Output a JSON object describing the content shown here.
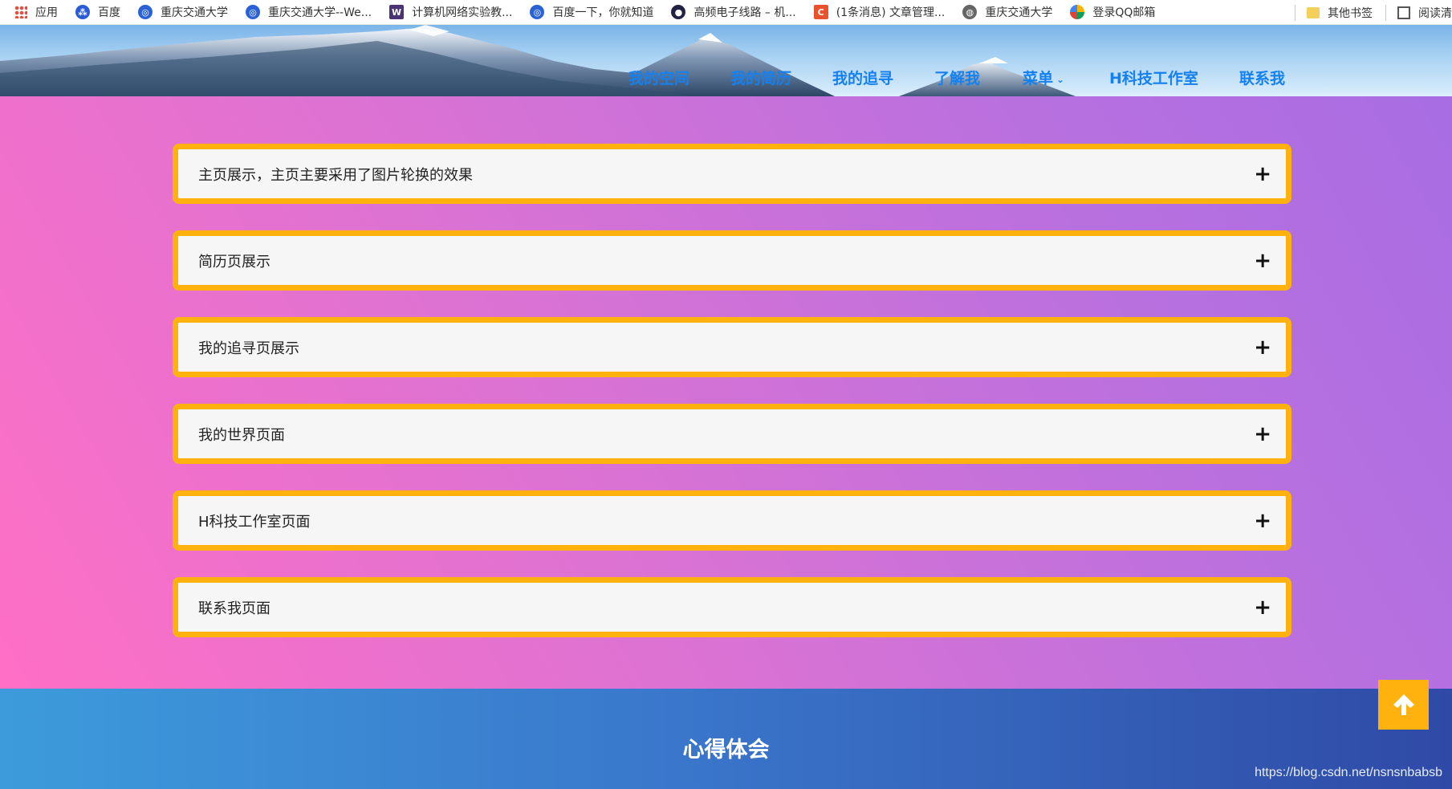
{
  "bookmarks": {
    "items": [
      {
        "label": "应用",
        "icon": "apps-grid-icon"
      },
      {
        "label": "百度",
        "icon": "baidu-paw-icon"
      },
      {
        "label": "重庆交通大学",
        "icon": "university-logo-icon"
      },
      {
        "label": "重庆交通大学--We...",
        "icon": "university-logo-icon"
      },
      {
        "label": "计算机网络实验教...",
        "icon": "w-logo-icon"
      },
      {
        "label": "百度一下，你就知道",
        "icon": "university-logo-icon"
      },
      {
        "label": "高频电子线路 – 机...",
        "icon": "dark-circle-icon"
      },
      {
        "label": "(1条消息) 文章管理...",
        "icon": "csdn-c-icon"
      },
      {
        "label": "重庆交通大学",
        "icon": "globe-icon"
      },
      {
        "label": "登录QQ邮箱",
        "icon": "qq-mail-icon"
      }
    ],
    "other_label": "其他书签",
    "reader_label": "阅读清"
  },
  "nav": {
    "items": [
      "我的空间",
      "我的简历",
      "我的追寻",
      "了解我",
      "菜单",
      "H科技工作室",
      "联系我"
    ],
    "menu_chevron": "⌄"
  },
  "accordion": {
    "items": [
      "主页展示，主页主要采用了图片轮换的效果",
      "简历页展示",
      "我的追寻页展示",
      "我的世界页面",
      "H科技工作室页面",
      "联系我页面"
    ],
    "plus": "+"
  },
  "bottom": {
    "title": "心得体会",
    "watermark": "https://blog.csdn.net/nsnsnbabsb"
  },
  "colors": {
    "accent_orange": "#ffb10d",
    "nav_blue": "#1580f0",
    "pink": "#ff6fc5",
    "purple": "#a86de3",
    "footer_blue": "#2f4aa6"
  }
}
